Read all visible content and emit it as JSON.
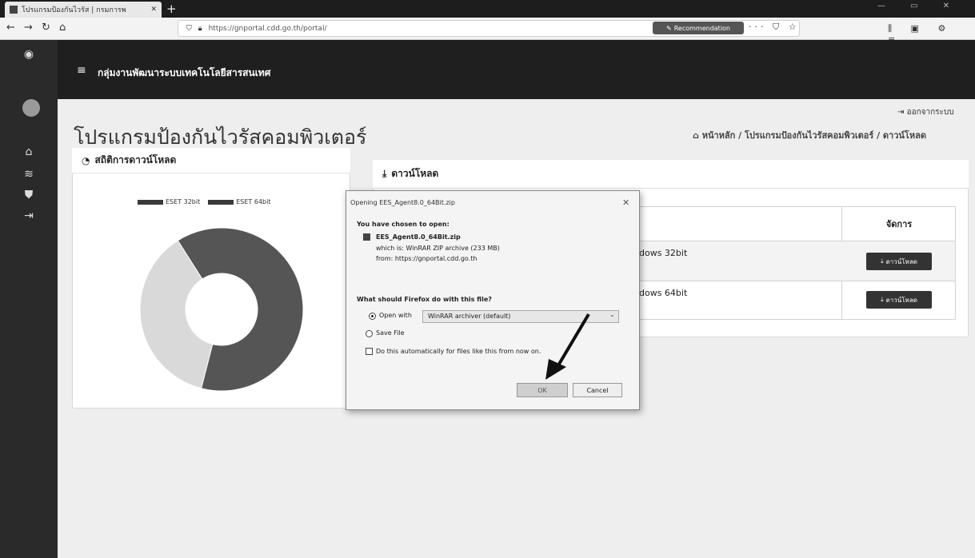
{
  "browser": {
    "tab_title": "โปรแกรมป้องกันไวรัส | กรมการพ",
    "tab_close": "✕",
    "new_tab": "+",
    "url": "https://gnportal.cdd.go.th/portal/",
    "recommendation": "Recommendation"
  },
  "header": {
    "site_name": "กลุ่มงานพัฒนาระบบเทคโนโลยีสารสนเทศ",
    "logout": "ออกจากระบบ"
  },
  "page": {
    "title": "โปรแกรมป้องกันไวรัสคอมพิวเตอร์",
    "breadcrumb": "หน้าหลัก / โปรแกรมป้องกันไวรัสคอมพิวเตอร์ / ดาวน์โหลด"
  },
  "stats_card": {
    "title": "สถิติการดาวน์โหลด",
    "legend": [
      "ESET 32bit",
      "ESET 64bit"
    ]
  },
  "chart_data": {
    "type": "pie",
    "categories": [
      "ESET 32bit",
      "ESET 64bit"
    ],
    "values": [
      37,
      63
    ],
    "legend_position": "top"
  },
  "download_card": {
    "title": "ดาวน์โหลด",
    "manage_header": "จัดการ",
    "rows": [
      {
        "name": "dows 32bit",
        "button": "ดาวน์โหลด"
      },
      {
        "name": "dows 64bit",
        "button": "ดาวน์โหลด"
      }
    ]
  },
  "dialog": {
    "title": "Opening EES_Agent8.0_64Bit.zip",
    "chosen_to_open": "You have chosen to open:",
    "file_name": "EES_Agent8.0_64Bit.zip",
    "which_is": "which is: WinRAR ZIP archive (233 MB)",
    "from": "from: https://gnportal.cdd.go.th",
    "question": "What should Firefox do with this file?",
    "open_with_label": "Open with",
    "open_with_value": "WinRAR archiver (default)",
    "save_file": "Save File",
    "auto_checkbox": "Do this automatically for files like this from now on.",
    "ok": "OK",
    "cancel": "Cancel"
  }
}
